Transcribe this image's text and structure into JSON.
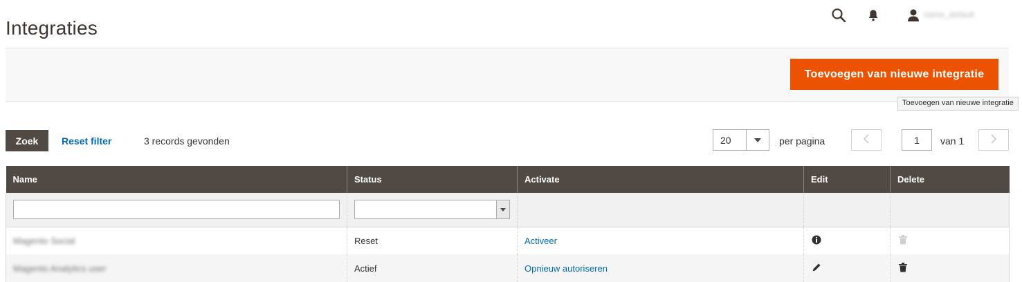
{
  "page": {
    "title": "Integraties"
  },
  "header": {
    "user_name": "name_default"
  },
  "actions": {
    "add_button_label": "Toevoegen van nieuwe integratie",
    "add_button_tooltip": "Toevoegen van nieuwe integratie",
    "accent_color": "#eb5202"
  },
  "toolbar": {
    "search_label": "Zoek",
    "reset_label": "Reset filter",
    "records_found": "3 records gevonden",
    "page_size": "20",
    "per_page_label": "per pagina",
    "current_page": "1",
    "of_pages": "van 1"
  },
  "grid": {
    "columns": [
      "Name",
      "Status",
      "Activate",
      "Edit",
      "Delete"
    ],
    "rows": [
      {
        "name": "Magento Social",
        "status": "Reset",
        "activate": "Activeer",
        "edit_icon": "info-icon",
        "delete_icon": "trash-icon-disabled"
      },
      {
        "name": "Magento Analytics user",
        "status": "Actief",
        "activate": "Opnieuw autoriseren",
        "edit_icon": "pencil-icon",
        "delete_icon": "trash-icon"
      }
    ]
  }
}
